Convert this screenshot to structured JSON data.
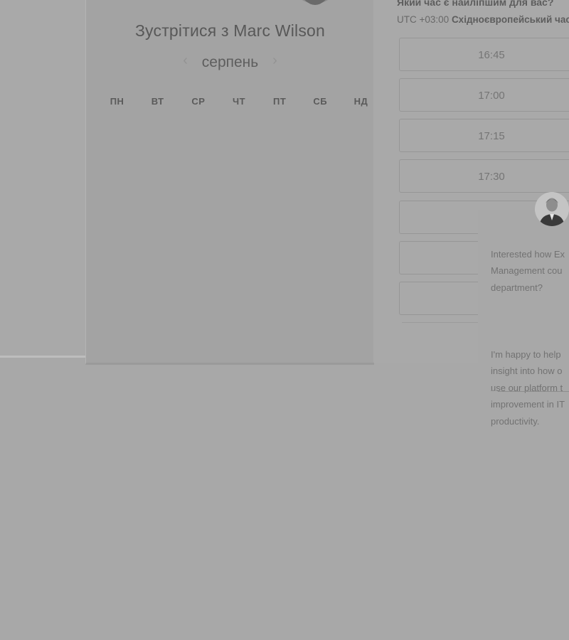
{
  "scheduler": {
    "meet_title": "Зустрітися з Marc Wilson",
    "month": "серпень",
    "prev_icon": "chevron-left-icon",
    "next_icon": "chevron-right-icon",
    "weekdays": [
      "ПН",
      "ВТ",
      "СР",
      "ЧТ",
      "ПТ",
      "СБ",
      "НД"
    ],
    "weeks": [
      [
        "",
        "",
        "",
        "",
        "",
        "",
        ""
      ],
      [
        "",
        "",
        "",
        "",
        "",
        "",
        ""
      ],
      [
        "",
        "",
        "",
        "",
        "",
        "",
        ""
      ],
      [
        "",
        "",
        "",
        "",
        "",
        "",
        ""
      ],
      [
        "",
        "",
        "",
        "",
        "",
        "",
        ""
      ]
    ],
    "question": "Який час є найліпшим для вас?",
    "timezone_prefix": "UTC +03:00",
    "timezone_name": "Східноєвропейський час",
    "slots": [
      "16:45",
      "17:00",
      "17:15",
      "17:30",
      "",
      "",
      ""
    ]
  },
  "chat": {
    "avatar_icon": "person-avatar-icon",
    "message_p1": "Interested how Ex\nManagement cou\ndepartment?",
    "message_p2": "I'm happy to help\ninsight into how o\nuse our platform t\nimprovement in IT\nproductivity."
  },
  "colors": {
    "overlay": "#a8a8a8",
    "text_dark": "#585858",
    "slot_border": "#969696"
  }
}
